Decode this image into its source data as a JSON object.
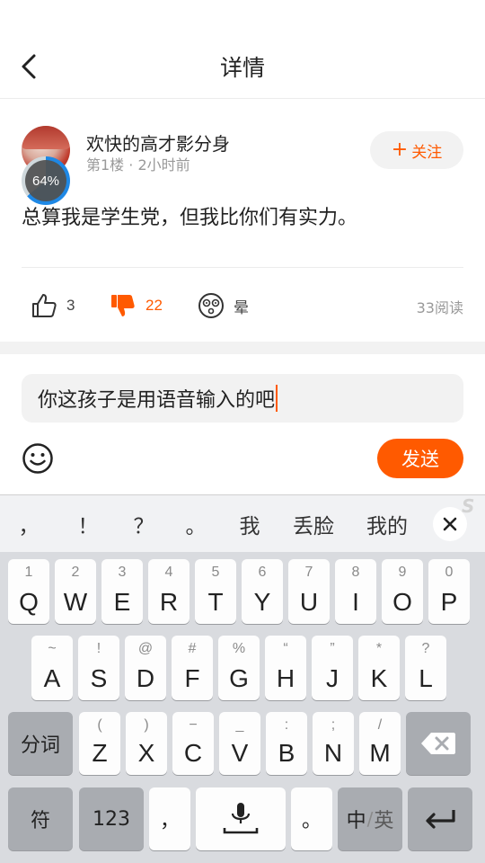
{
  "header": {
    "title": "详情"
  },
  "post": {
    "username": "欢快的高才影分身",
    "floor": "第1楼",
    "time": "2小时前",
    "follow_label": "关注",
    "avatar_progress": "64%",
    "text": "总算我是学生党，但我比你们有实力。",
    "likes": "3",
    "dislikes": "22",
    "dizzy_label": "晕",
    "read_count": "33阅读"
  },
  "composer": {
    "input_value": "你这孩子是用语音输入的吧",
    "send_label": "发送"
  },
  "keyboard": {
    "candidates": [
      "，",
      "！",
      "？",
      "。",
      "我",
      "丢脸",
      "我的"
    ],
    "row1": [
      {
        "hint": "1",
        "key": "Q"
      },
      {
        "hint": "2",
        "key": "W"
      },
      {
        "hint": "3",
        "key": "E"
      },
      {
        "hint": "4",
        "key": "R"
      },
      {
        "hint": "5",
        "key": "T"
      },
      {
        "hint": "6",
        "key": "Y"
      },
      {
        "hint": "7",
        "key": "U"
      },
      {
        "hint": "8",
        "key": "I"
      },
      {
        "hint": "9",
        "key": "O"
      },
      {
        "hint": "0",
        "key": "P"
      }
    ],
    "row2": [
      {
        "hint": "~",
        "key": "A"
      },
      {
        "hint": "!",
        "key": "S"
      },
      {
        "hint": "@",
        "key": "D"
      },
      {
        "hint": "#",
        "key": "F"
      },
      {
        "hint": "%",
        "key": "G"
      },
      {
        "hint": "“",
        "key": "H"
      },
      {
        "hint": "”",
        "key": "J"
      },
      {
        "hint": "*",
        "key": "K"
      },
      {
        "hint": "?",
        "key": "L"
      }
    ],
    "row3": [
      {
        "hint": "(",
        "key": "Z"
      },
      {
        "hint": ")",
        "key": "X"
      },
      {
        "hint": "−",
        "key": "C"
      },
      {
        "hint": "_",
        "key": "V"
      },
      {
        "hint": ":",
        "key": "B"
      },
      {
        "hint": ";",
        "key": "N"
      },
      {
        "hint": "/",
        "key": "M"
      }
    ],
    "segment_label": "分词",
    "symbols_label": "符",
    "numbers_label": "123",
    "comma_label": "，",
    "period_label": "。",
    "lang_zh": "中",
    "lang_sep": "/",
    "lang_en": "英"
  },
  "colors": {
    "accent": "#ff5a00",
    "progress": "#1e88e5"
  }
}
